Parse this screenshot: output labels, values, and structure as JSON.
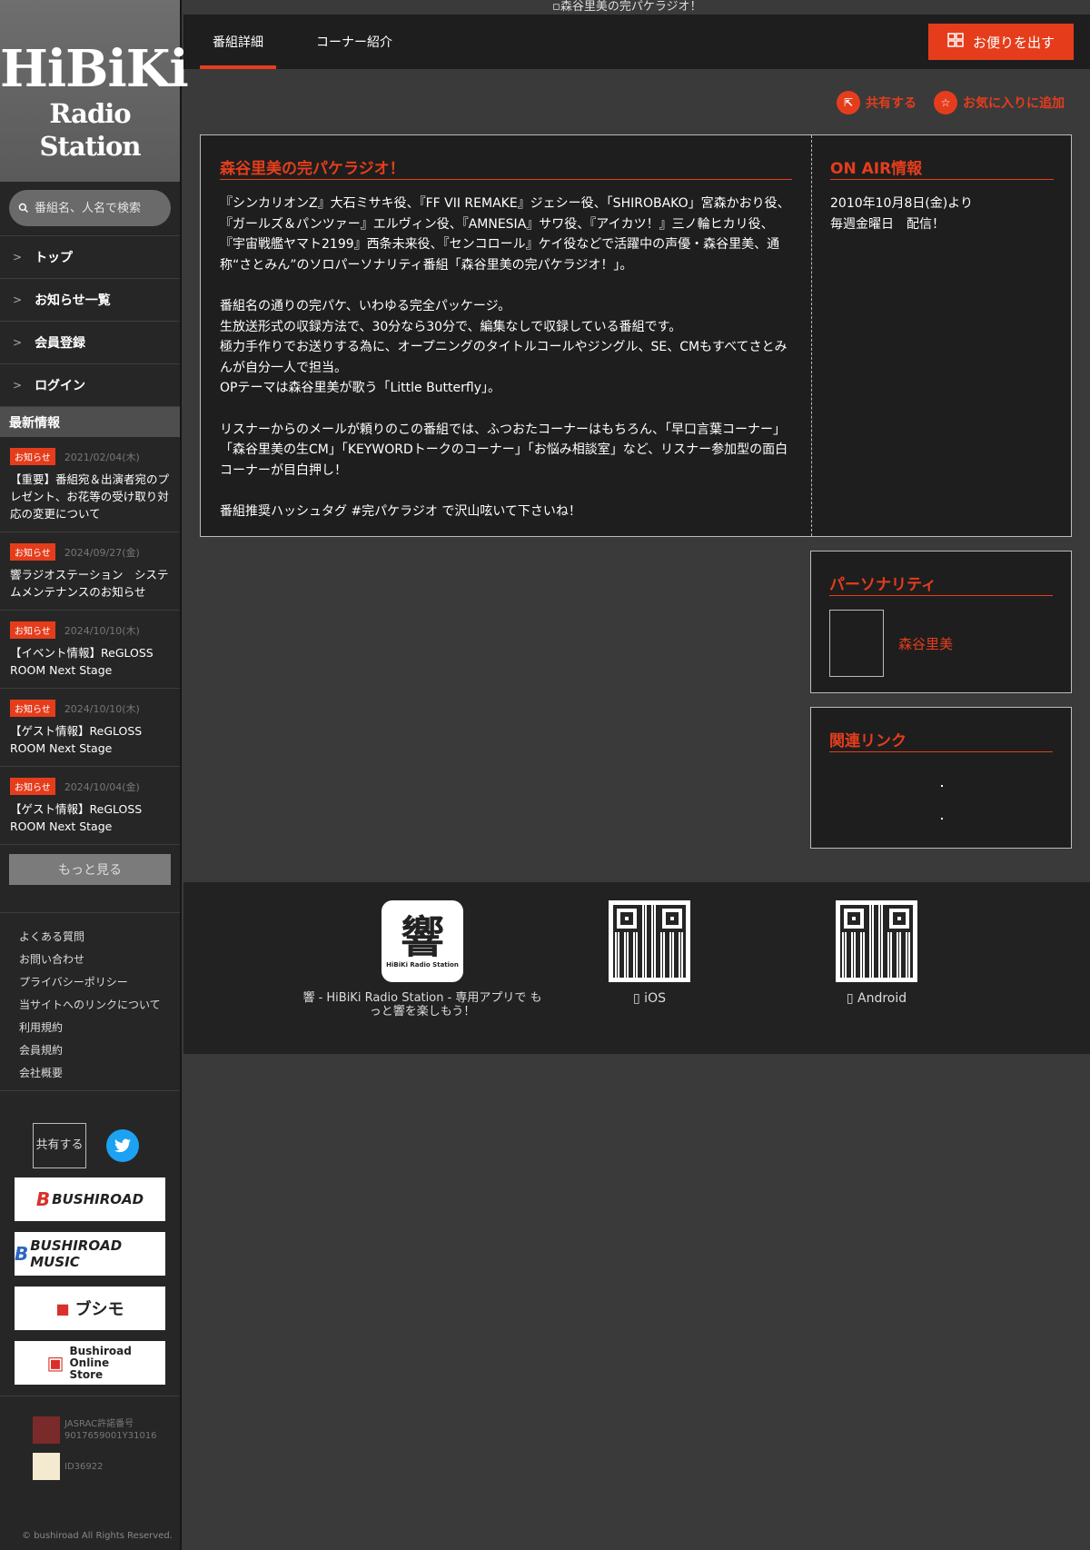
{
  "header": {
    "broken_image_alt": "森谷里美の完パケラジオ！",
    "tabs": [
      "番組詳細",
      "コーナー紹介"
    ],
    "letter_button": "お便りを出す",
    "share_label": "共有する",
    "favorite_label": "お気に入りに追加"
  },
  "sidebar": {
    "logo_line1": "HiBiKi",
    "logo_line2": "Radio Station",
    "search_placeholder": "番組名、人名で検索",
    "nav": [
      "トップ",
      "お知らせ一覧",
      "会員登録",
      "ログイン"
    ],
    "news_heading": "最新情報",
    "news": [
      {
        "badge": "お知らせ",
        "date": "2021/02/04(木)",
        "text": "【重要】番組宛＆出演者宛のプレゼント、お花等の受け取り対応の変更について"
      },
      {
        "badge": "お知らせ",
        "date": "2024/09/27(金)",
        "text": "響ラジオステーション　システムメンテナンスのお知らせ"
      },
      {
        "badge": "お知らせ",
        "date": "2024/10/10(木)",
        "text": "【イベント情報】ReGLOSS ROOM Next Stage"
      },
      {
        "badge": "お知らせ",
        "date": "2024/10/10(木)",
        "text": "【ゲスト情報】ReGLOSS ROOM Next Stage"
      },
      {
        "badge": "お知らせ",
        "date": "2024/10/04(金)",
        "text": "【ゲスト情報】ReGLOSS ROOM Next Stage"
      }
    ],
    "more_button": "もっと見る",
    "footer_links": [
      "よくある質問",
      "お問い合わせ",
      "プライバシーポリシー",
      "当サイトへのリンクについて",
      "利用規約",
      "会員規約",
      "会社概要"
    ],
    "share_box": "共有する",
    "banners": [
      "BUSHIROAD",
      "BUSHIROAD MUSIC",
      "ブシモ",
      "Bushiroad Online Store"
    ],
    "jasrac_label": "JASRAC許諾番号",
    "jasrac_number": "9017659001Y31016",
    "license2": "ID36922",
    "copyright": "bushiroad All Rights Reserved."
  },
  "program": {
    "title": "森谷里美の完パケラジオ！",
    "description": "『シンカリオンZ』大石ミサキ役、『FF VII REMAKE』ジェシー役、「SHIROBAKO」宮森かおり役、『ガールズ＆パンツァー』エルヴィン役、『AMNESIA』サワ役、『アイカツ！』三ノ輪ヒカリ役、『宇宙戦艦ヤマト2199』西条未来役、『センコロール』ケイ役などで活躍中の声優・森谷里美、通称“さとみん”のソロパーソナリティ番組「森谷里美の完パケラジオ！」。\n\n番組名の通りの完パケ、いわゆる完全パッケージ。\n生放送形式の収録方法で、30分なら30分で、編集なしで収録している番組です。\n極力手作りでお送りする為に、オープニングのタイトルコールやジングル、SE、CMもすべてさとみんが自分一人で担当。\nOPテーマは森谷里美が歌う「Little Butterfly」。\n\nリスナーからのメールが頼りのこの番組では、ふつおたコーナーはもちろん、「早口言葉コーナー」「森谷里美の生CM」「KEYWORDトークのコーナー」「お悩み相談室」など、リスナー参加型の面白コーナーが目白押し！\n\n番組推奨ハッシュタグ #完パケラジオ で沢山呟いて下さいね！",
    "onair_title": "ON AIR情報",
    "onair_text": "2010年10月8日(金)より\n毎週金曜日　配信！",
    "personality_title": "パーソナリティ",
    "personality_name": "森谷里美",
    "links_title": "関連リンク"
  },
  "footer": {
    "app_name": "響",
    "app_sub": "HiBiKi Radio Station",
    "app_text": "響 - HiBiKi Radio Station - 専用アプリで もっと響を楽しもう！",
    "ios_label": " iOS",
    "android_label": " Android"
  },
  "colors": {
    "accent": "#e53d1c",
    "background": "#3a3a3a",
    "panel": "#1e1e1e",
    "twitter": "#1da1f2"
  }
}
